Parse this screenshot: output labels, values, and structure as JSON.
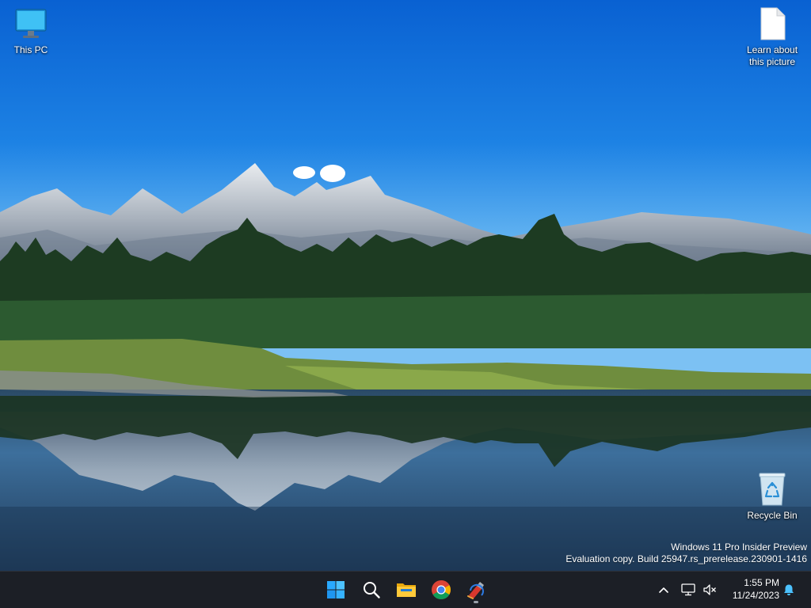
{
  "desktop": {
    "icons": [
      {
        "id": "this-pc",
        "label": "This PC",
        "icon": "monitor-icon"
      },
      {
        "id": "learn",
        "label": "Learn about\nthis picture",
        "icon": "document-icon"
      },
      {
        "id": "recycle",
        "label": "Recycle Bin",
        "icon": "recycle-bin-icon"
      }
    ],
    "watermark": {
      "line1": "Windows 11 Pro Insider Preview",
      "line2": "Evaluation copy. Build 25947.rs_prerelease.230901-1416"
    }
  },
  "taskbar": {
    "pinned": [
      {
        "id": "start",
        "icon": "windows-start-icon"
      },
      {
        "id": "search",
        "icon": "search-icon"
      },
      {
        "id": "explorer",
        "icon": "file-explorer-icon"
      },
      {
        "id": "chrome",
        "icon": "chrome-icon"
      },
      {
        "id": "ccleaner",
        "icon": "ccleaner-icon",
        "running": true
      }
    ],
    "tray": {
      "time": "1:55 PM",
      "date": "11/24/2023",
      "icons": [
        "chevron-up-icon",
        "network-icon",
        "volume-muted-icon",
        "notification-bell-icon"
      ]
    }
  },
  "colors": {
    "taskbar_bg": "#1c1f26",
    "accent_blue": "#29a9ff",
    "sky_top": "#0a67d6",
    "text": "#ffffff"
  }
}
